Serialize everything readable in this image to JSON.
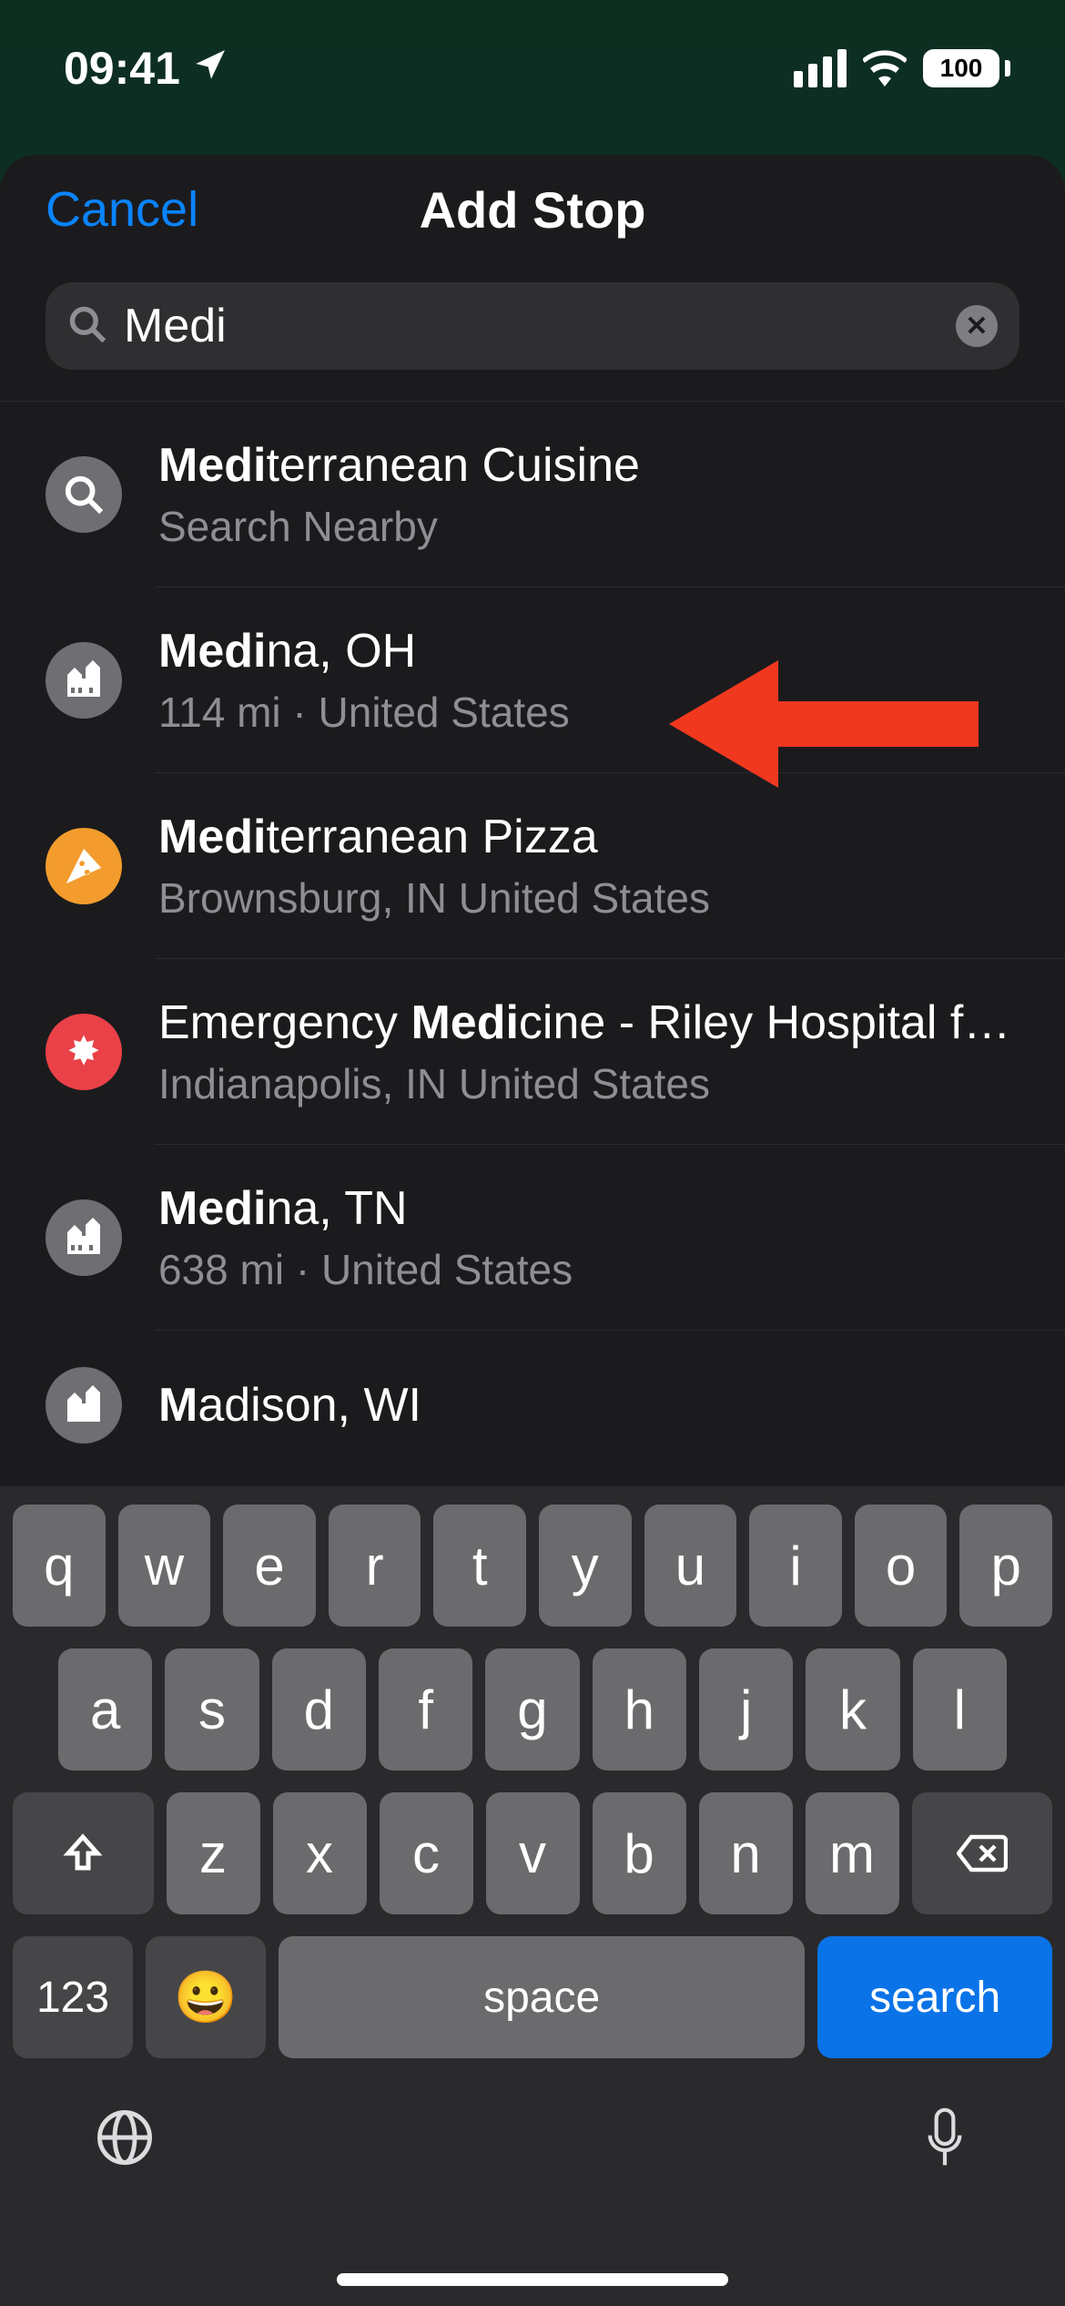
{
  "status": {
    "time": "09:41",
    "battery": "100"
  },
  "header": {
    "cancel": "Cancel",
    "title": "Add Stop"
  },
  "search": {
    "value": "Medi"
  },
  "results": [
    {
      "prefix": "Medi",
      "rest": "terranean Cuisine",
      "sub": "Search Nearby",
      "icon": "search"
    },
    {
      "prefix": "Medi",
      "rest": "na, OH",
      "sub": "114 mi · United States",
      "icon": "city"
    },
    {
      "prefix": "Medi",
      "rest": "terranean Pizza",
      "sub": "Brownsburg, IN  United States",
      "icon": "pizza"
    },
    {
      "prefix_text": "Emergency ",
      "bold": "Medi",
      "suffix": "cine - Riley Hospital for...",
      "sub": "Indianapolis, IN  United States",
      "icon": "medical"
    },
    {
      "prefix": "Medi",
      "rest": "na, TN",
      "sub": "638 mi · United States",
      "icon": "city"
    },
    {
      "prefix": "M",
      "rest": "adison, WI",
      "sub": "",
      "icon": "city"
    }
  ],
  "keyboard": {
    "row1": [
      "q",
      "w",
      "e",
      "r",
      "t",
      "y",
      "u",
      "i",
      "o",
      "p"
    ],
    "row2": [
      "a",
      "s",
      "d",
      "f",
      "g",
      "h",
      "j",
      "k",
      "l"
    ],
    "row3": [
      "z",
      "x",
      "c",
      "v",
      "b",
      "n",
      "m"
    ],
    "num": "123",
    "space": "space",
    "search": "search"
  }
}
